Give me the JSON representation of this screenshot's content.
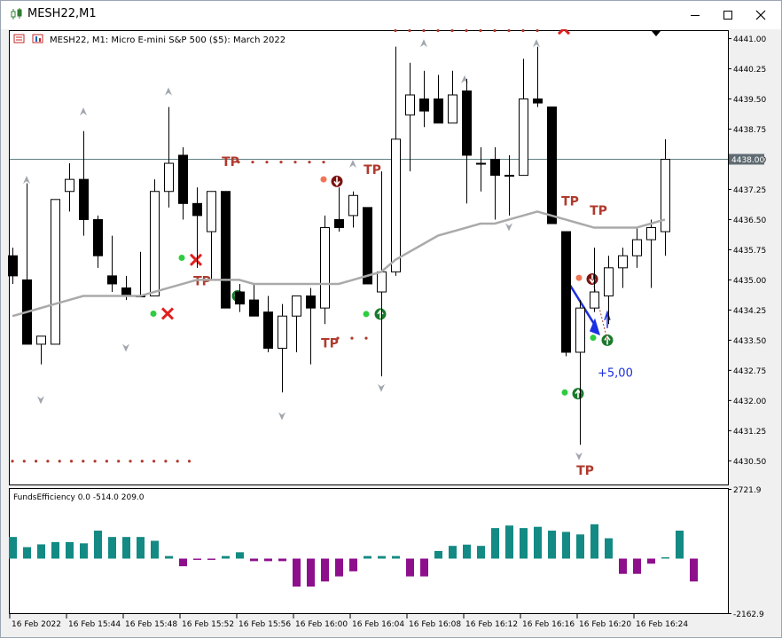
{
  "window": {
    "title": "MESH22,M1",
    "header_text": "MESH22, M1:  Micro E-mini S&P 500 ($5): March 2022"
  },
  "chart_data": [
    {
      "type": "candlestick",
      "symbol": "MESH22",
      "timeframe": "M1",
      "ylim": [
        4429.9,
        4441.2
      ],
      "y_ticks": [
        "4441.00",
        "4440.25",
        "4439.50",
        "4438.75",
        "4438.00",
        "4437.25",
        "4436.50",
        "4435.75",
        "4435.00",
        "4434.25",
        "4433.50",
        "4432.75",
        "4432.00",
        "4431.25",
        "4430.50"
      ],
      "current_price": "4438.00",
      "x_labels": [
        "16 Feb 2022",
        "16 Feb 15:44",
        "16 Feb 15:48",
        "16 Feb 15:52",
        "16 Feb 15:56",
        "16 Feb 16:00",
        "16 Feb 16:04",
        "16 Feb 16:08",
        "16 Feb 16:12",
        "16 Feb 16:16",
        "16 Feb 16:20",
        "16 Feb 16:24"
      ],
      "candles": [
        {
          "o": 4435.6,
          "h": 4435.8,
          "l": 4434.9,
          "c": 4435.1
        },
        {
          "o": 4435.0,
          "h": 4437.4,
          "l": 4433.4,
          "c": 4433.4
        },
        {
          "o": 4433.4,
          "h": 4433.6,
          "l": 4432.9,
          "c": 4433.6
        },
        {
          "o": 4433.4,
          "h": 4437.0,
          "l": 4433.4,
          "c": 4437.0
        },
        {
          "o": 4437.2,
          "h": 4437.9,
          "l": 4436.7,
          "c": 4437.5
        },
        {
          "o": 4437.5,
          "h": 4438.7,
          "l": 4436.1,
          "c": 4436.5
        },
        {
          "o": 4436.5,
          "h": 4436.6,
          "l": 4435.3,
          "c": 4435.6
        },
        {
          "o": 4435.1,
          "h": 4436.1,
          "l": 4434.7,
          "c": 4434.9
        },
        {
          "o": 4434.8,
          "h": 4435.1,
          "l": 4434.5,
          "c": 4434.6
        },
        {
          "o": 4434.6,
          "h": 4435.7,
          "l": 4434.6,
          "c": 4434.6
        },
        {
          "o": 4434.6,
          "h": 4437.5,
          "l": 4434.6,
          "c": 4437.2
        },
        {
          "o": 4437.2,
          "h": 4439.3,
          "l": 4436.8,
          "c": 4437.9
        },
        {
          "o": 4438.1,
          "h": 4438.3,
          "l": 4436.5,
          "c": 4436.9
        },
        {
          "o": 4436.9,
          "h": 4437.3,
          "l": 4435.3,
          "c": 4436.6
        },
        {
          "o": 4436.2,
          "h": 4436.9,
          "l": 4435.0,
          "c": 4437.2
        },
        {
          "o": 4437.2,
          "h": 4437.2,
          "l": 4434.3,
          "c": 4434.3
        },
        {
          "o": 4434.7,
          "h": 4434.9,
          "l": 4434.2,
          "c": 4434.4
        },
        {
          "o": 4434.5,
          "h": 4434.9,
          "l": 4434.2,
          "c": 4434.1
        },
        {
          "o": 4434.2,
          "h": 4434.6,
          "l": 4433.2,
          "c": 4433.3
        },
        {
          "o": 4433.3,
          "h": 4434.4,
          "l": 4432.2,
          "c": 4434.1
        },
        {
          "o": 4434.1,
          "h": 4434.4,
          "l": 4433.2,
          "c": 4434.6
        },
        {
          "o": 4434.6,
          "h": 4434.8,
          "l": 4432.9,
          "c": 4434.3
        },
        {
          "o": 4434.3,
          "h": 4436.6,
          "l": 4433.9,
          "c": 4436.3
        },
        {
          "o": 4436.5,
          "h": 4437.3,
          "l": 4436.2,
          "c": 4436.3
        },
        {
          "o": 4436.6,
          "h": 4437.2,
          "l": 4436.3,
          "c": 4437.1
        },
        {
          "o": 4436.8,
          "h": 4436.8,
          "l": 4434.9,
          "c": 4434.9
        },
        {
          "o": 4434.7,
          "h": 4437.7,
          "l": 4432.6,
          "c": 4435.2
        },
        {
          "o": 4435.2,
          "h": 4440.8,
          "l": 4435.1,
          "c": 4438.5
        },
        {
          "o": 4439.1,
          "h": 4440.4,
          "l": 4437.7,
          "c": 4439.6
        },
        {
          "o": 4439.5,
          "h": 4440.2,
          "l": 4438.8,
          "c": 4439.2
        },
        {
          "o": 4439.5,
          "h": 4440.1,
          "l": 4438.9,
          "c": 4438.9
        },
        {
          "o": 4438.9,
          "h": 4440.2,
          "l": 4438.9,
          "c": 4439.6
        },
        {
          "o": 4439.7,
          "h": 4440.0,
          "l": 4436.9,
          "c": 4438.1
        },
        {
          "o": 4437.9,
          "h": 4438.3,
          "l": 4437.2,
          "c": 4437.9
        },
        {
          "o": 4438.0,
          "h": 4438.3,
          "l": 4436.5,
          "c": 4437.6
        },
        {
          "o": 4437.6,
          "h": 4438.1,
          "l": 4436.6,
          "c": 4437.6
        },
        {
          "o": 4437.6,
          "h": 4440.5,
          "l": 4437.6,
          "c": 4439.5
        },
        {
          "o": 4439.5,
          "h": 4440.8,
          "l": 4439.3,
          "c": 4439.4
        },
        {
          "o": 4439.3,
          "h": 4439.3,
          "l": 4436.4,
          "c": 4436.4
        },
        {
          "o": 4436.2,
          "h": 4436.2,
          "l": 4433.1,
          "c": 4433.2
        },
        {
          "o": 4433.2,
          "h": 4434.5,
          "l": 4430.9,
          "c": 4434.3
        },
        {
          "o": 4434.3,
          "h": 4435.8,
          "l": 4434.2,
          "c": 4434.7
        },
        {
          "o": 4434.6,
          "h": 4435.6,
          "l": 4433.9,
          "c": 4435.3
        },
        {
          "o": 4435.3,
          "h": 4435.8,
          "l": 4434.8,
          "c": 4435.6
        },
        {
          "o": 4435.6,
          "h": 4436.3,
          "l": 4435.3,
          "c": 4436.0
        },
        {
          "o": 4436.0,
          "h": 4436.5,
          "l": 4434.8,
          "c": 4436.3
        },
        {
          "o": 4436.2,
          "h": 4438.5,
          "l": 4435.6,
          "c": 4438.0
        }
      ],
      "moving_average": [
        4434.1,
        4434.2,
        4434.3,
        4434.4,
        4434.5,
        4434.6,
        4434.6,
        4434.6,
        4434.6,
        4434.6,
        4434.7,
        4434.8,
        4434.9,
        4435.0,
        4435.0,
        4435.0,
        4435.0,
        4434.9,
        4434.9,
        4434.9,
        4434.9,
        4434.9,
        4434.9,
        4434.9,
        4435.0,
        4435.1,
        4435.2,
        4435.5,
        4435.7,
        4435.9,
        4436.1,
        4436.2,
        4436.3,
        4436.4,
        4436.4,
        4436.5,
        4436.6,
        4436.7,
        4436.6,
        4436.5,
        4436.4,
        4436.3,
        4436.3,
        4436.3,
        4436.3,
        4436.4,
        4436.5
      ],
      "annotations": {
        "tp_label": "TP",
        "profit_label": "+5,00"
      }
    },
    {
      "type": "bar",
      "title": "FundsEfficiency 0.0 -514.0 209.0",
      "ylim": [
        -2162.9,
        2721.9
      ],
      "y_ticks": [
        "2721.9",
        "-2162.9"
      ],
      "values": [
        850,
        450,
        560,
        650,
        650,
        600,
        1100,
        850,
        850,
        850,
        700,
        100,
        -300,
        -50,
        -50,
        100,
        250,
        -100,
        -100,
        -100,
        -1100,
        -1100,
        -900,
        -700,
        -500,
        100,
        100,
        100,
        -700,
        -700,
        300,
        500,
        550,
        500,
        1200,
        1300,
        1200,
        1250,
        1100,
        1050,
        950,
        1350,
        800,
        -600,
        -600,
        -200,
        50,
        1100,
        -900
      ]
    }
  ]
}
